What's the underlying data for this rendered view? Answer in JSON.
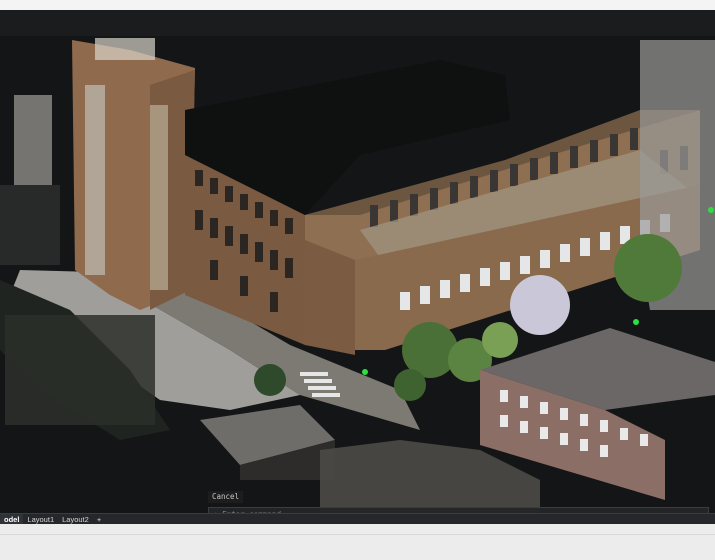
{
  "command_line": {
    "history_text": "Cancel",
    "prompt_symbol": ":",
    "input_value": "",
    "input_placeholder": "Enter command"
  },
  "layout_tabs": {
    "tabs": [
      {
        "label": "odel",
        "active": true
      },
      {
        "label": "Layout1",
        "active": false
      },
      {
        "label": "Layout2",
        "active": false
      }
    ],
    "add_label": "+"
  },
  "viewport": {
    "background": "#141516",
    "content": "point-cloud-scan"
  }
}
